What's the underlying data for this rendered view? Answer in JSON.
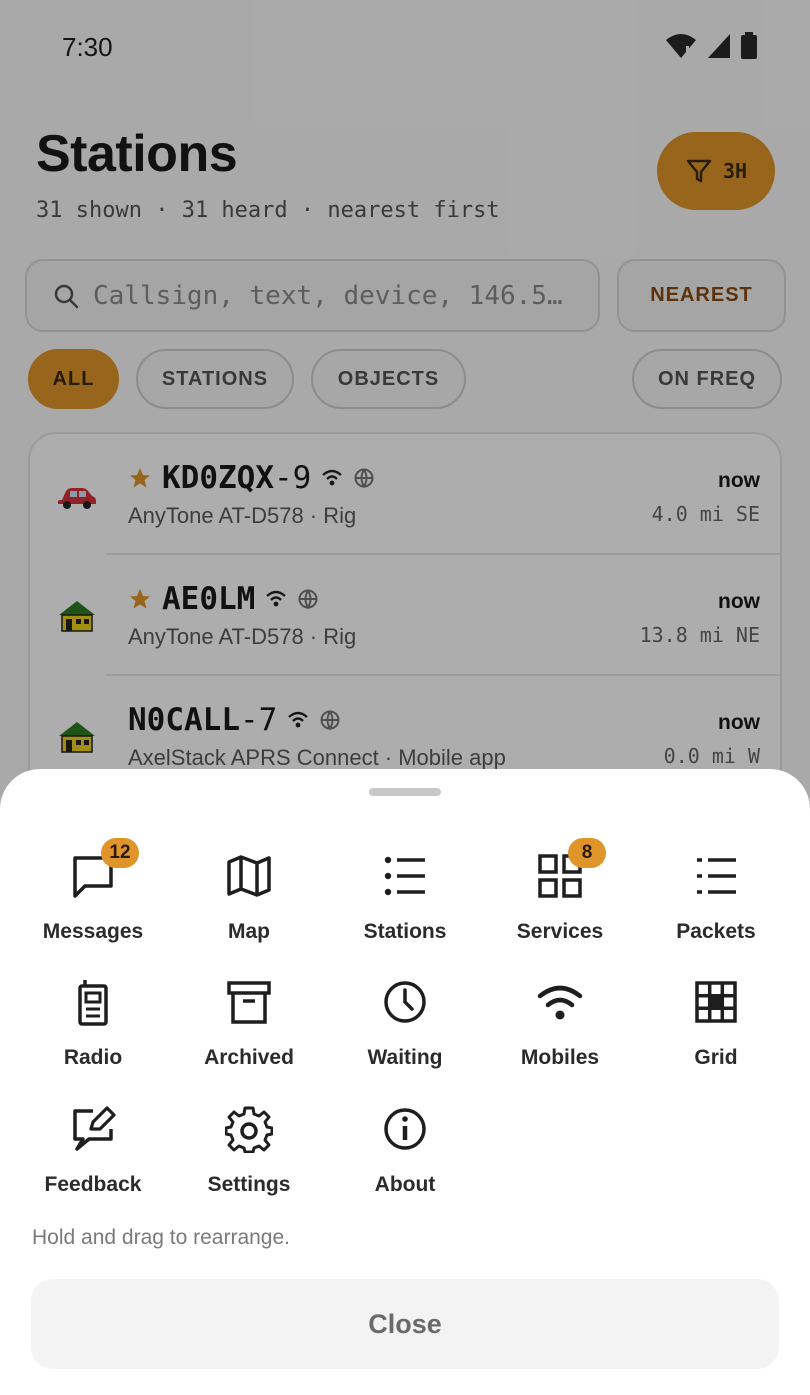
{
  "status_bar": {
    "time": "7:30",
    "icons": [
      "wifi-alert-icon",
      "cell-signal-icon",
      "battery-icon"
    ]
  },
  "header": {
    "title": "Stations",
    "subtitle": "31 shown · 31 heard · nearest first",
    "filter_label": "3H"
  },
  "search": {
    "placeholder": "Callsign, text, device, 146.52…",
    "sort_label": "NEAREST"
  },
  "chips": {
    "all": "ALL",
    "stations": "STATIONS",
    "objects": "OBJECTS",
    "on_freq": "ON FREQ"
  },
  "stations": [
    {
      "call": "KD0ZQX",
      "ssid": "-9",
      "starred": true,
      "icon": "car-icon",
      "device": "AnyTone AT-D578 · Rig",
      "time": "now",
      "distance": "4.0 mi SE"
    },
    {
      "call": "AE0LM",
      "ssid": "",
      "starred": true,
      "icon": "house-icon",
      "device": "AnyTone AT-D578 · Rig",
      "time": "now",
      "distance": "13.8 mi NE"
    },
    {
      "call": "N0CALL",
      "ssid": "-7",
      "starred": false,
      "icon": "house-icon",
      "device": "AxelStack APRS Connect · Mobile app",
      "time": "now",
      "distance": "0.0 mi W"
    }
  ],
  "sheet": {
    "items": [
      {
        "label": "Messages",
        "icon": "message-icon",
        "badge": "12"
      },
      {
        "label": "Map",
        "icon": "map-icon"
      },
      {
        "label": "Stations",
        "icon": "list-icon"
      },
      {
        "label": "Services",
        "icon": "services-grid-icon",
        "badge": "8"
      },
      {
        "label": "Packets",
        "icon": "packets-list-icon"
      },
      {
        "label": "Radio",
        "icon": "radio-icon"
      },
      {
        "label": "Archived",
        "icon": "archive-icon"
      },
      {
        "label": "Waiting",
        "icon": "clock-icon"
      },
      {
        "label": "Mobiles",
        "icon": "wifi-icon"
      },
      {
        "label": "Grid",
        "icon": "grid-icon"
      },
      {
        "label": "Feedback",
        "icon": "feedback-icon"
      },
      {
        "label": "Settings",
        "icon": "gear-icon"
      },
      {
        "label": "About",
        "icon": "info-icon"
      }
    ],
    "hint": "Hold and drag to rearrange.",
    "close_label": "Close"
  },
  "colors": {
    "accent": "#e0952a",
    "star": "#e0952a",
    "house_roof": "#2f7d24",
    "house_body": "#f2d21a",
    "car": "#d8333a"
  }
}
